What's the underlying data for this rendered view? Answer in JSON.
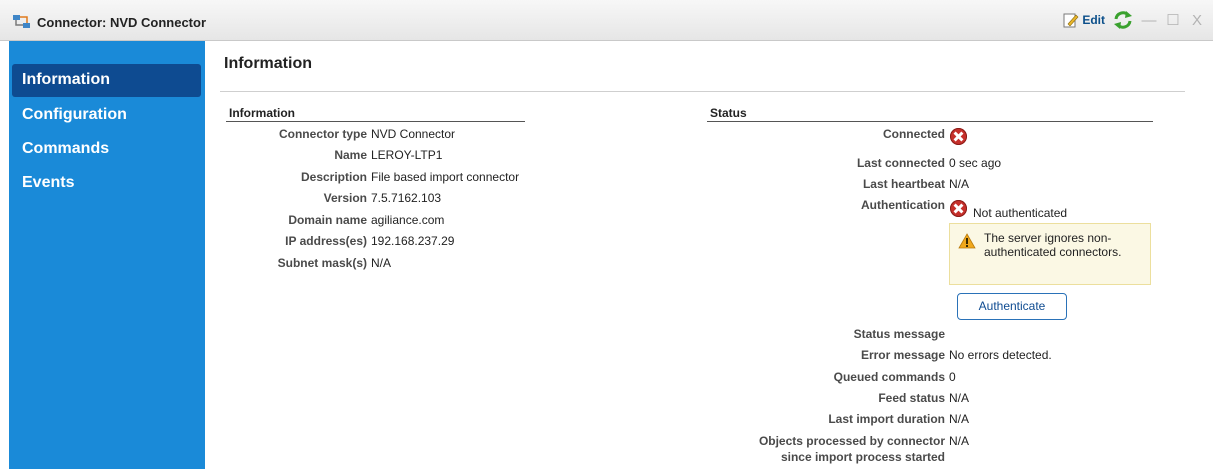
{
  "window": {
    "title": "Connector: NVD Connector",
    "edit_label": "Edit",
    "minimize": "—",
    "maximize": "☐",
    "close": "X"
  },
  "sidebar": {
    "items": [
      {
        "label": "Information",
        "active": true
      },
      {
        "label": "Configuration",
        "active": false
      },
      {
        "label": "Commands",
        "active": false
      },
      {
        "label": "Events",
        "active": false
      }
    ]
  },
  "main": {
    "title": "Information",
    "information": {
      "heading": "Information",
      "rows": [
        {
          "label": "Connector type",
          "value": "NVD Connector"
        },
        {
          "label": "Name",
          "value": "LEROY-LTP1"
        },
        {
          "label": "Description",
          "value": "File based import connector"
        },
        {
          "label": "Version",
          "value": "7.5.7162.103"
        },
        {
          "label": "Domain name",
          "value": "agiliance.com"
        },
        {
          "label": "IP address(es)",
          "value": "192.168.237.29"
        },
        {
          "label": "Subnet mask(s)",
          "value": "N/A"
        }
      ]
    },
    "status": {
      "heading": "Status",
      "connected_label": "Connected",
      "last_connected_label": "Last connected",
      "last_connected_value": "0 sec ago",
      "last_heartbeat_label": "Last heartbeat",
      "last_heartbeat_value": "N/A",
      "authentication_label": "Authentication",
      "authentication_value": "Not authenticated",
      "warning": "The server ignores non-authenticated connectors.",
      "authenticate_button": "Authenticate",
      "status_message_label": "Status message",
      "error_message_label": "Error message",
      "error_message_value": "No errors detected.",
      "queued_commands_label": "Queued commands",
      "queued_commands_value": "0",
      "feed_status_label": "Feed status",
      "feed_status_value": "N/A",
      "last_import_duration_label": "Last import duration",
      "last_import_duration_value": "N/A",
      "objects_processed_label_1": "Objects processed by connector",
      "objects_processed_label_2": "since import process started",
      "objects_processed_value": "N/A"
    }
  },
  "colors": {
    "sidebar_bg": "#1a8ad8",
    "sidebar_active": "#0e4b91",
    "error": "#c6302b",
    "warning_bg": "#fbf8e4"
  }
}
